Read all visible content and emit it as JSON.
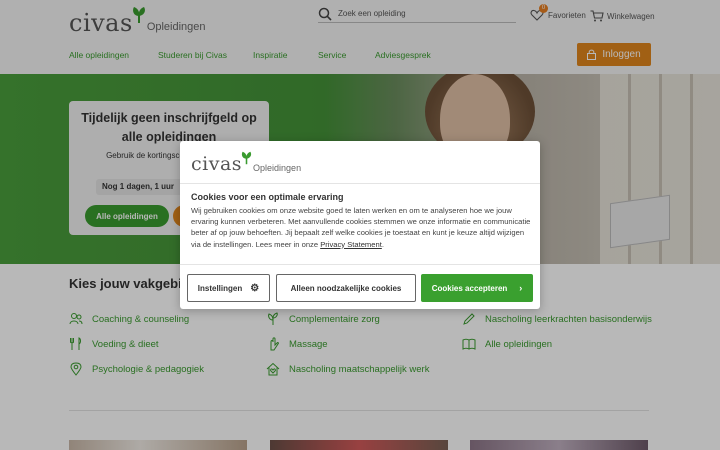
{
  "header": {
    "logo_word": "civas",
    "logo_sub": "Opleidingen",
    "search_placeholder": "Zoek een opleiding",
    "favorites_label": "Favorieten",
    "favorites_count": "0",
    "cart_label": "Winkelwagen",
    "login_label": "Inloggen",
    "nav": [
      "Alle opleidingen",
      "Studeren bij Civas",
      "Inspiratie",
      "Service",
      "Adviesgesprek"
    ]
  },
  "promo": {
    "title": "Tijdelijk geen inschrijfgeld op alle opleidingen",
    "text": "Gebruik de kortingscode winkelwag",
    "countdown": "Nog 1 dagen, 1 uur",
    "button": "Alle opleidingen"
  },
  "vakgebied": {
    "title": "Kies jouw vakgebie",
    "categories": [
      {
        "label": "Coaching & counseling",
        "icon": "people-icon"
      },
      {
        "label": "Complementaire zorg",
        "icon": "herb-icon"
      },
      {
        "label": "Nascholing leerkrachten basisonderwijs",
        "icon": "pencil-icon"
      },
      {
        "label": "Voeding & dieet",
        "icon": "cutlery-icon"
      },
      {
        "label": "Massage",
        "icon": "hand-icon"
      },
      {
        "label": "Alle opleidingen",
        "icon": "book-icon"
      },
      {
        "label": "Psychologie & pedagogiek",
        "icon": "location-icon"
      },
      {
        "label": "Nascholing maatschappelijk werk",
        "icon": "home-heart-icon"
      }
    ]
  },
  "cookie": {
    "logo_word": "civas",
    "logo_sub": "Opleidingen",
    "title": "Cookies voor een optimale ervaring",
    "text": "Wij gebruiken cookies om onze website goed te laten werken en om te analyseren hoe we jouw ervaring kunnen verbeteren. Met aanvullende cookies stemmen we onze informatie en communicatie beter af op jouw behoeften. Jij bepaalt zelf welke cookies je toestaat en kunt je keuze altijd wijzigen via de instellingen. Lees meer in onze",
    "link": "Privacy Statement",
    "btn_settings": "Instellingen",
    "btn_necessary": "Alleen noodzakelijke cookies",
    "btn_accept": "Cookies accepteren"
  },
  "colors": {
    "green": "#3a9b2f",
    "orange": "#e0861d"
  }
}
